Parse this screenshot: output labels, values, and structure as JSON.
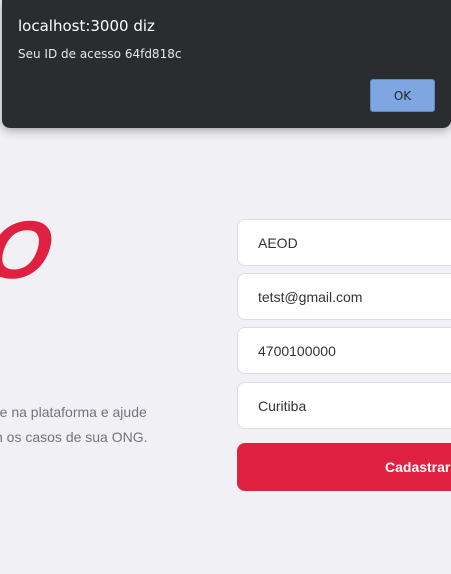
{
  "alert": {
    "title": "localhost:3000 diz",
    "message": "Seu ID de acesso 64fd818c",
    "ok_label": "OK"
  },
  "logo": {
    "text": "RO"
  },
  "description": {
    "line1": "re na plataforma e ajude",
    "line2": "n os casos de sua ONG."
  },
  "form": {
    "name_value": "AEOD",
    "email_value": "tetst@gmail.com",
    "whatsapp_value": "4700100000",
    "city_value": "Curitiba",
    "submit_label": "Cadastrar"
  },
  "colors": {
    "brand": "#e02041",
    "background": "#f0f0f5",
    "alert_bg": "#2b2c30",
    "ok_button": "#7ea6e0"
  }
}
